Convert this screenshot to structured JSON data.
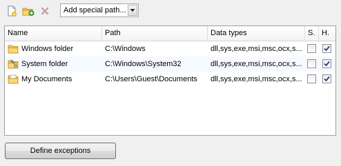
{
  "toolbar": {
    "new_icon": "new-file-icon",
    "add_folder_icon": "add-folder-icon",
    "delete_icon": "delete-icon",
    "special_path": {
      "selected": "Add special path...",
      "dropdown_icon": "chevron-down-icon"
    }
  },
  "table": {
    "columns": [
      "Name",
      "Path",
      "Data types",
      "S.",
      "H."
    ],
    "rows": [
      {
        "name": "Windows folder",
        "icon": "folder-icon",
        "path": "C:\\Windows",
        "data_types": "dll,sys,exe,msi,msc,ocx,s...",
        "s": false,
        "h": true
      },
      {
        "name": "System folder",
        "icon": "system-folder-icon",
        "path": "C:\\Windows\\System32",
        "data_types": "dll,sys,exe,msi,msc,ocx,s...",
        "s": false,
        "h": true
      },
      {
        "name": "My Documents",
        "icon": "documents-folder-icon",
        "path": "C:\\Users\\Guest\\Documents",
        "data_types": "dll,sys,exe,msi,msc,ocx,s...",
        "s": false,
        "h": true
      }
    ]
  },
  "actions": {
    "define_exceptions": "Define exceptions"
  },
  "colors": {
    "window_bg": "#f0f0f0",
    "folder": "#f2c75c",
    "add_green": "#3ea83e",
    "delete_disabled": "#c9a0a0",
    "check_blue": "#1a3d8c"
  }
}
